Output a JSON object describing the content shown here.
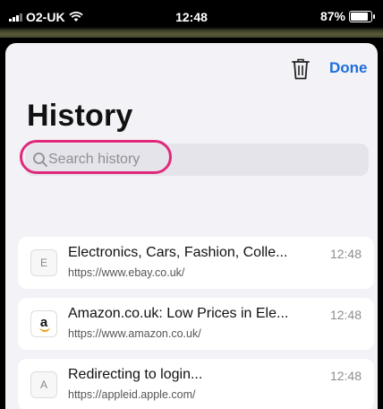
{
  "status_bar": {
    "carrier": "O2-UK",
    "time": "12:48",
    "battery": "87%",
    "battery_level": 0.87
  },
  "toolbar": {
    "trash_icon": "trash-icon",
    "done_label": "Done"
  },
  "page_title": "History",
  "search": {
    "placeholder": "Search history",
    "value": ""
  },
  "history": [
    {
      "favicon": "E",
      "title": "Electronics, Cars, Fashion, Colle...",
      "url": "https://www.ebay.co.uk/",
      "time": "12:48"
    },
    {
      "favicon": "a",
      "title": "Amazon.co.uk: Low Prices in Ele...",
      "url": "https://www.amazon.co.uk/",
      "time": "12:48"
    },
    {
      "favicon": "A",
      "title": "Redirecting to login...",
      "url": "https://appleid.apple.com/",
      "time": "12:48"
    }
  ],
  "colors": {
    "accent": "#1e6fd9",
    "highlight": "#e0287a",
    "sheet_bg": "#f2f2f7"
  }
}
